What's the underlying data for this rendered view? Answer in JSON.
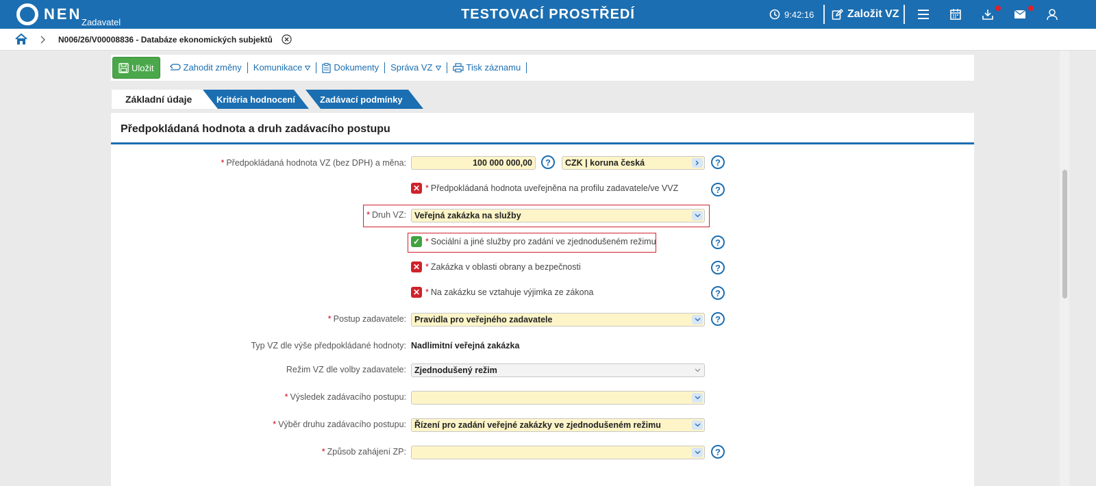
{
  "topbar": {
    "logo_text": "NEN",
    "logo_sub": "Zadavatel",
    "env_title": "TESTOVACÍ PROSTŘEDÍ",
    "clock": "9:42:16",
    "create_label": "Založit VZ",
    "icons": [
      "clock-icon",
      "edit-icon",
      "menu-icon",
      "calendar-icon",
      "download-icon",
      "mail-icon",
      "user-icon"
    ],
    "accent": "#1b6eb1"
  },
  "breadcrumb": {
    "text": "N006/26/V00008836 - Databáze ekonomických subjektů"
  },
  "toolbar": {
    "save": "Uložit",
    "discard": "Zahodit změny",
    "communication": "Komunikace",
    "documents": "Dokumenty",
    "management": "Správa VZ",
    "print": "Tisk záznamu"
  },
  "tabs": [
    {
      "label": "Základní údaje"
    },
    {
      "label": "Kritéria hodnocení"
    },
    {
      "label": "Zadávací podmínky"
    }
  ],
  "section": {
    "title": "Předpokládaná hodnota a druh zadávacího postupu"
  },
  "form": {
    "value_label": "Předpokládaná hodnota VZ (bez DPH) a měna:",
    "value": "100 000 000,00",
    "currency": "CZK | koruna česká",
    "published_label": "Předpokládaná hodnota uveřejněna na profilu zadavatele/ve VVZ",
    "druh_label": "Druh VZ:",
    "druh_value": "Veřejná zakázka na služby",
    "social_label": "Sociální a jiné služby pro zadání ve zjednodušeném režimu",
    "defense_label": "Zakázka v oblasti obrany a bezpečnosti",
    "exception_label": "Na zakázku se vztahuje výjimka ze zákona",
    "postup_label": "Postup zadavatele:",
    "postup_value": "Pravidla pro veřejného zadavatele",
    "typ_label": "Typ VZ dle výše předpokládané hodnoty:",
    "typ_value": "Nadlimitní veřejná zakázka",
    "rezim_label": "Režim VZ dle volby zadavatele:",
    "rezim_value": "Zjednodušený režim",
    "vysledek_label": "Výsledek zadávacího postupu:",
    "vysledek_value": "",
    "vyber_label": "Výběr druhu zadávacího postupu:",
    "vyber_value": "Řízení pro zadání veřejné zakázky ve zjednodušeném režimu",
    "zpusob_label": "Způsob zahájení ZP:",
    "zpusob_value": ""
  }
}
